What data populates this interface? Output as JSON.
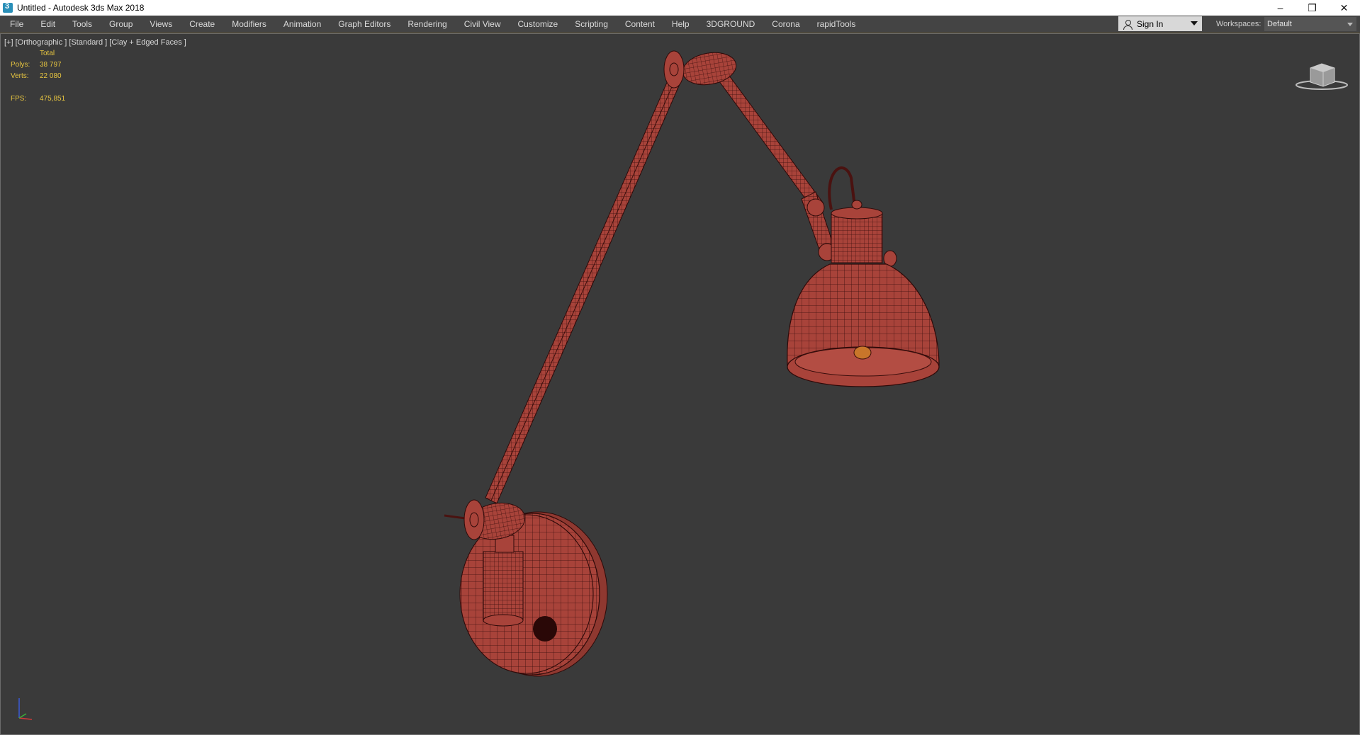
{
  "window": {
    "title": "Untitled - Autodesk 3ds Max 2018",
    "controls": [
      "–",
      "❐",
      "✕"
    ]
  },
  "menu": {
    "items": [
      "File",
      "Edit",
      "Tools",
      "Group",
      "Views",
      "Create",
      "Modifiers",
      "Animation",
      "Graph Editors",
      "Rendering",
      "Civil View",
      "Customize",
      "Scripting",
      "Content",
      "Help",
      "3DGROUND",
      "Corona",
      "rapidTools"
    ]
  },
  "account": {
    "sign_in_label": "Sign In"
  },
  "workspaces": {
    "label": "Workspaces:",
    "value": "Default"
  },
  "viewport": {
    "label": "[+] [Orthographic ] [Standard ] [Clay + Edged Faces ]",
    "stats": {
      "header": "Total",
      "polys_label": "Polys:",
      "polys_value": "38 797",
      "verts_label": "Verts:",
      "verts_value": "22 080",
      "fps_label": "FPS:",
      "fps_value": "475,851"
    }
  },
  "colors": {
    "viewport_bg": "#3a3a3a",
    "model_fill": "#a8433a",
    "model_wire": "#3a0e0c",
    "stats_text": "#e8c640"
  },
  "icons": {
    "app": "3dsmax-app-icon",
    "user": "user-icon",
    "viewcube": "viewcube-icon",
    "axis": "axis-tripod-icon"
  }
}
